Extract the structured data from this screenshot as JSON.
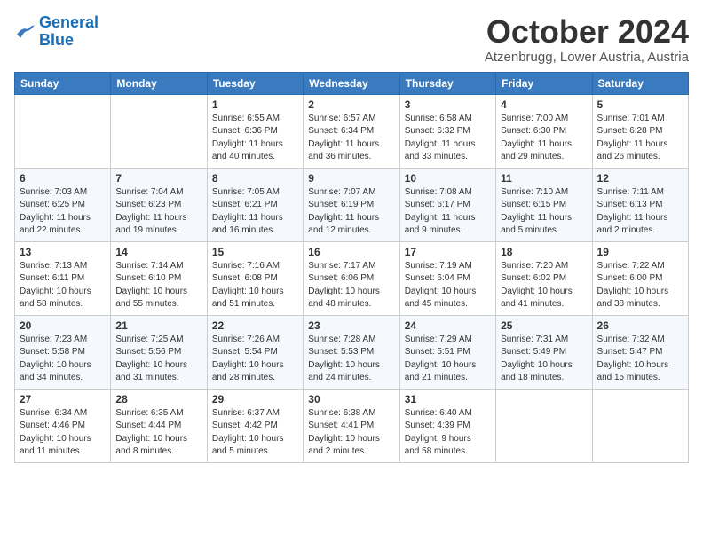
{
  "header": {
    "logo_general": "General",
    "logo_blue": "Blue",
    "month": "October 2024",
    "location": "Atzenbrugg, Lower Austria, Austria"
  },
  "weekdays": [
    "Sunday",
    "Monday",
    "Tuesday",
    "Wednesday",
    "Thursday",
    "Friday",
    "Saturday"
  ],
  "weeks": [
    [
      {
        "day": "",
        "info": ""
      },
      {
        "day": "",
        "info": ""
      },
      {
        "day": "1",
        "info": "Sunrise: 6:55 AM\nSunset: 6:36 PM\nDaylight: 11 hours\nand 40 minutes."
      },
      {
        "day": "2",
        "info": "Sunrise: 6:57 AM\nSunset: 6:34 PM\nDaylight: 11 hours\nand 36 minutes."
      },
      {
        "day": "3",
        "info": "Sunrise: 6:58 AM\nSunset: 6:32 PM\nDaylight: 11 hours\nand 33 minutes."
      },
      {
        "day": "4",
        "info": "Sunrise: 7:00 AM\nSunset: 6:30 PM\nDaylight: 11 hours\nand 29 minutes."
      },
      {
        "day": "5",
        "info": "Sunrise: 7:01 AM\nSunset: 6:28 PM\nDaylight: 11 hours\nand 26 minutes."
      }
    ],
    [
      {
        "day": "6",
        "info": "Sunrise: 7:03 AM\nSunset: 6:25 PM\nDaylight: 11 hours\nand 22 minutes."
      },
      {
        "day": "7",
        "info": "Sunrise: 7:04 AM\nSunset: 6:23 PM\nDaylight: 11 hours\nand 19 minutes."
      },
      {
        "day": "8",
        "info": "Sunrise: 7:05 AM\nSunset: 6:21 PM\nDaylight: 11 hours\nand 16 minutes."
      },
      {
        "day": "9",
        "info": "Sunrise: 7:07 AM\nSunset: 6:19 PM\nDaylight: 11 hours\nand 12 minutes."
      },
      {
        "day": "10",
        "info": "Sunrise: 7:08 AM\nSunset: 6:17 PM\nDaylight: 11 hours\nand 9 minutes."
      },
      {
        "day": "11",
        "info": "Sunrise: 7:10 AM\nSunset: 6:15 PM\nDaylight: 11 hours\nand 5 minutes."
      },
      {
        "day": "12",
        "info": "Sunrise: 7:11 AM\nSunset: 6:13 PM\nDaylight: 11 hours\nand 2 minutes."
      }
    ],
    [
      {
        "day": "13",
        "info": "Sunrise: 7:13 AM\nSunset: 6:11 PM\nDaylight: 10 hours\nand 58 minutes."
      },
      {
        "day": "14",
        "info": "Sunrise: 7:14 AM\nSunset: 6:10 PM\nDaylight: 10 hours\nand 55 minutes."
      },
      {
        "day": "15",
        "info": "Sunrise: 7:16 AM\nSunset: 6:08 PM\nDaylight: 10 hours\nand 51 minutes."
      },
      {
        "day": "16",
        "info": "Sunrise: 7:17 AM\nSunset: 6:06 PM\nDaylight: 10 hours\nand 48 minutes."
      },
      {
        "day": "17",
        "info": "Sunrise: 7:19 AM\nSunset: 6:04 PM\nDaylight: 10 hours\nand 45 minutes."
      },
      {
        "day": "18",
        "info": "Sunrise: 7:20 AM\nSunset: 6:02 PM\nDaylight: 10 hours\nand 41 minutes."
      },
      {
        "day": "19",
        "info": "Sunrise: 7:22 AM\nSunset: 6:00 PM\nDaylight: 10 hours\nand 38 minutes."
      }
    ],
    [
      {
        "day": "20",
        "info": "Sunrise: 7:23 AM\nSunset: 5:58 PM\nDaylight: 10 hours\nand 34 minutes."
      },
      {
        "day": "21",
        "info": "Sunrise: 7:25 AM\nSunset: 5:56 PM\nDaylight: 10 hours\nand 31 minutes."
      },
      {
        "day": "22",
        "info": "Sunrise: 7:26 AM\nSunset: 5:54 PM\nDaylight: 10 hours\nand 28 minutes."
      },
      {
        "day": "23",
        "info": "Sunrise: 7:28 AM\nSunset: 5:53 PM\nDaylight: 10 hours\nand 24 minutes."
      },
      {
        "day": "24",
        "info": "Sunrise: 7:29 AM\nSunset: 5:51 PM\nDaylight: 10 hours\nand 21 minutes."
      },
      {
        "day": "25",
        "info": "Sunrise: 7:31 AM\nSunset: 5:49 PM\nDaylight: 10 hours\nand 18 minutes."
      },
      {
        "day": "26",
        "info": "Sunrise: 7:32 AM\nSunset: 5:47 PM\nDaylight: 10 hours\nand 15 minutes."
      }
    ],
    [
      {
        "day": "27",
        "info": "Sunrise: 6:34 AM\nSunset: 4:46 PM\nDaylight: 10 hours\nand 11 minutes."
      },
      {
        "day": "28",
        "info": "Sunrise: 6:35 AM\nSunset: 4:44 PM\nDaylight: 10 hours\nand 8 minutes."
      },
      {
        "day": "29",
        "info": "Sunrise: 6:37 AM\nSunset: 4:42 PM\nDaylight: 10 hours\nand 5 minutes."
      },
      {
        "day": "30",
        "info": "Sunrise: 6:38 AM\nSunset: 4:41 PM\nDaylight: 10 hours\nand 2 minutes."
      },
      {
        "day": "31",
        "info": "Sunrise: 6:40 AM\nSunset: 4:39 PM\nDaylight: 9 hours\nand 58 minutes."
      },
      {
        "day": "",
        "info": ""
      },
      {
        "day": "",
        "info": ""
      }
    ]
  ]
}
